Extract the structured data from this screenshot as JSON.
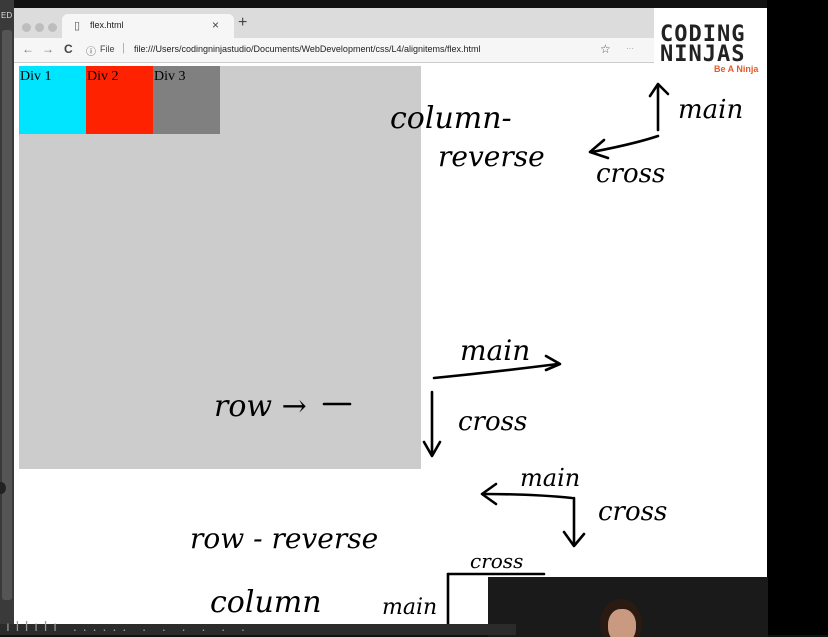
{
  "browser": {
    "left_strip_label": "ED",
    "tab": {
      "title": "flex.html",
      "close": "×",
      "new_tab": "+"
    },
    "nav": {
      "back": "←",
      "forward": "→",
      "reload": "C"
    },
    "address": {
      "info_icon": "ⓘ",
      "file_label": "File",
      "separator": "|",
      "url": "file:///Users/codingninjastudio/Documents/WebDevelopment/css/L4/alignitems/flex.html"
    },
    "bookmark_icon": "☆",
    "extension_hint": "··· "
  },
  "logo": {
    "line1a": "C",
    "line1b": "ODING",
    "line2a": "N",
    "line2b": "INJAS",
    "tagline": "Be A Ninja"
  },
  "page": {
    "items": [
      {
        "label": "Div 1",
        "color": "#00e5ff"
      },
      {
        "label": "Div 2",
        "color": "#ff2200"
      },
      {
        "label": "Div 3",
        "color": "#808080"
      }
    ],
    "container_color": "#cccccc"
  },
  "notes": {
    "column_reverse_1": "column-",
    "column_reverse_2": "reverse",
    "cr_main": "main",
    "cr_cross": "cross",
    "row_label": "row →",
    "row_main": "main",
    "row_cross": "cross",
    "row_reverse": "row - reverse",
    "rr_main": "main",
    "rr_cross": "cross",
    "column": "column",
    "col_main": "main",
    "col_cross": "cross"
  },
  "caption_text": "ıllılı ...... . . . . . ."
}
